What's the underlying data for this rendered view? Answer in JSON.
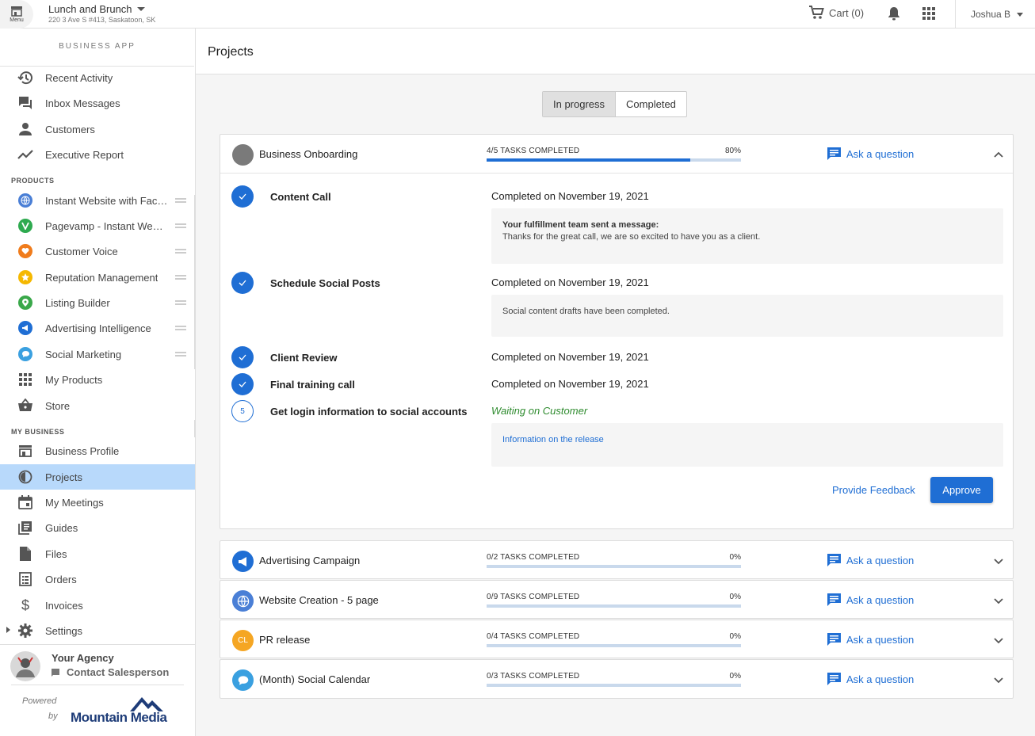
{
  "topbar": {
    "menu_label": "Menu",
    "business_name": "Lunch and Brunch",
    "business_address": "220 3 Ave S #413, Saskatoon, SK",
    "cart_label": "Cart (0)",
    "user_name": "Joshua B"
  },
  "sidebar": {
    "title": "BUSINESS APP",
    "main_items": [
      {
        "label": "Recent Activity",
        "icon": "history-icon"
      },
      {
        "label": "Inbox Messages",
        "icon": "forum-icon"
      },
      {
        "label": "Customers",
        "icon": "person-icon"
      },
      {
        "label": "Executive Report",
        "icon": "trend-icon"
      }
    ],
    "products_heading": "PRODUCTS",
    "products": [
      {
        "label": "Instant Website with Facebook",
        "icon": "globe-icon",
        "color": "#4a7fd6"
      },
      {
        "label": "Pagevamp - Instant Website",
        "icon": "pagevamp-icon",
        "color": "#2eaa4f"
      },
      {
        "label": "Customer Voice",
        "icon": "heart-icon",
        "color": "#f07c1c"
      },
      {
        "label": "Reputation Management",
        "icon": "star-icon",
        "color": "#f5b800"
      },
      {
        "label": "Listing Builder",
        "icon": "pin-icon",
        "color": "#3aa84a"
      },
      {
        "label": "Advertising Intelligence",
        "icon": "megaphone-icon",
        "color": "#1f6ed4"
      },
      {
        "label": "Social Marketing",
        "icon": "chat-bubble-icon",
        "color": "#3aa0e0"
      },
      {
        "label": "My Products",
        "icon": "grid-icon"
      },
      {
        "label": "Store",
        "icon": "basket-icon"
      }
    ],
    "mybusiness_heading": "MY BUSINESS",
    "mybusiness": [
      {
        "label": "Business Profile",
        "icon": "storefront-icon"
      },
      {
        "label": "Projects",
        "icon": "projects-icon"
      },
      {
        "label": "My Meetings",
        "icon": "calendar-icon"
      },
      {
        "label": "Guides",
        "icon": "library-icon"
      },
      {
        "label": "Files",
        "icon": "file-icon"
      },
      {
        "label": "Orders",
        "icon": "list-icon"
      },
      {
        "label": "Invoices",
        "icon": "dollar-icon"
      },
      {
        "label": "Settings",
        "icon": "gear-icon"
      }
    ],
    "agency_name": "Your Agency",
    "agency_contact": "Contact Salesperson",
    "powered": "Powered",
    "by": "by",
    "brand": "Mountain Media"
  },
  "main": {
    "title": "Projects",
    "tabs": [
      "In progress",
      "Completed"
    ],
    "ask_label": "Ask a question",
    "expanded_project": {
      "name": "Business Onboarding",
      "progress_label": "4/5 TASKS COMPLETED",
      "progress_pct_label": "80%",
      "progress": 0.8,
      "tasks": [
        {
          "name": "Content Call",
          "status": "Completed on November 19, 2021",
          "msg_title": "Your fulfillment team sent a message:",
          "msg_body": "Thanks for the great call, we are so excited to have you as a client."
        },
        {
          "name": "Schedule Social Posts",
          "status": "Completed on November 19, 2021",
          "msg_body": "Social content drafts have been completed."
        },
        {
          "name": "Client Review",
          "status": "Completed on November 19, 2021"
        },
        {
          "name": "Final training call",
          "status": "Completed on November 19, 2021"
        },
        {
          "name": "Get login information to social accounts",
          "number": "5",
          "status": "Waiting on Customer",
          "link": "Information on the release"
        }
      ],
      "feedback_label": "Provide Feedback",
      "approve_label": "Approve"
    },
    "projects": [
      {
        "name": "Advertising Campaign",
        "progress_label": "0/2 TASKS COMPLETED",
        "pct": "0%",
        "icon": "megaphone-icon",
        "color": "#1f6ed4"
      },
      {
        "name": "Website Creation - 5 page",
        "progress_label": "0/9 TASKS COMPLETED",
        "pct": "0%",
        "icon": "globe-icon",
        "color": "#4a7fd6"
      },
      {
        "name": "PR release",
        "progress_label": "0/4 TASKS COMPLETED",
        "pct": "0%",
        "icon": "initials-icon",
        "initials": "CL",
        "color": "#f5a623"
      },
      {
        "name": "(Month) Social Calendar",
        "progress_label": "0/3 TASKS COMPLETED",
        "pct": "0%",
        "icon": "chat-bubble-icon",
        "color": "#3aa0e0"
      }
    ]
  }
}
